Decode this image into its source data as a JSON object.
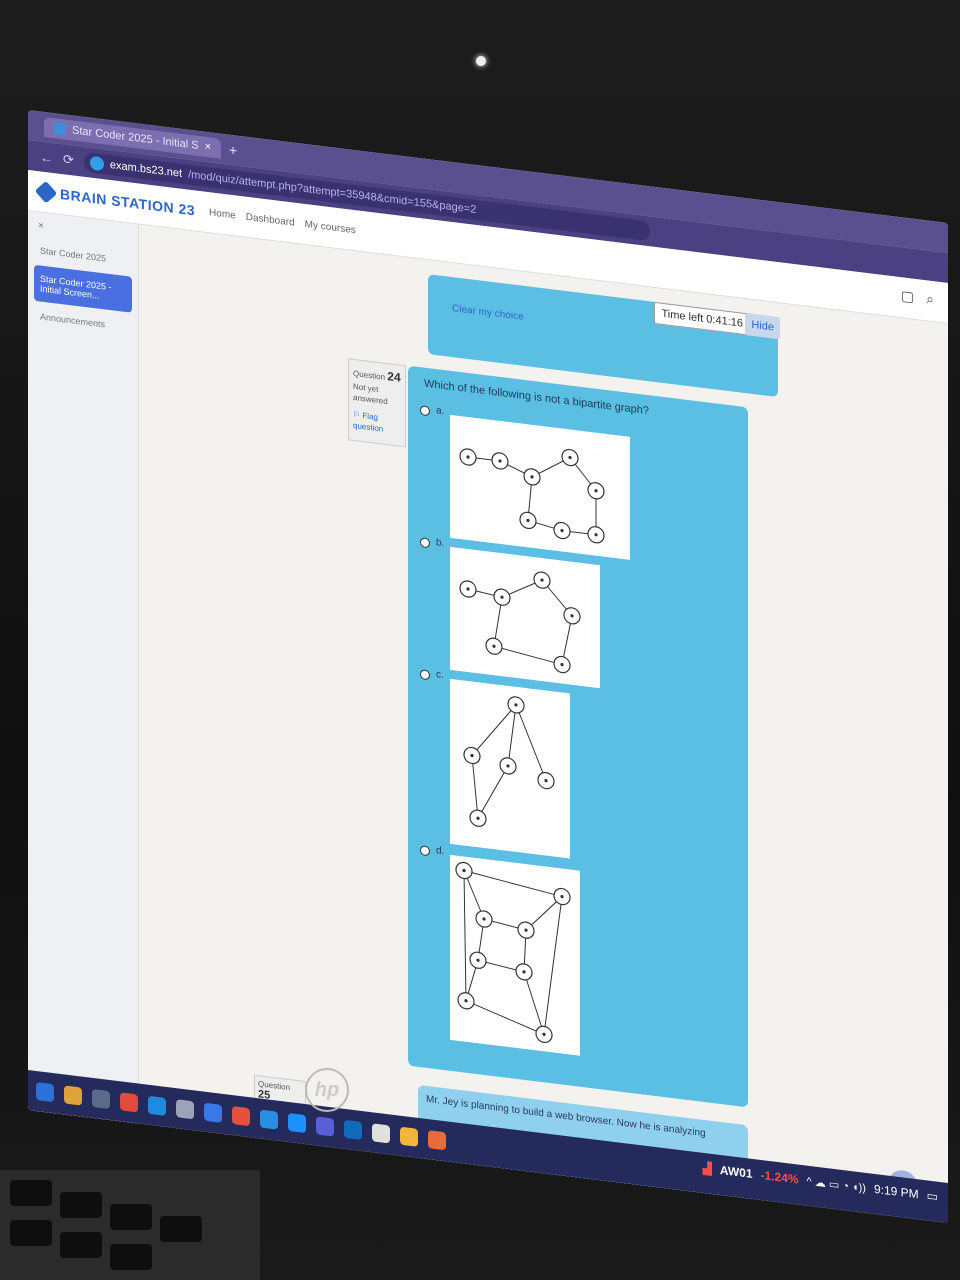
{
  "browser": {
    "tab_title": "Star Coder 2025 - Initial S",
    "tab_close": "×",
    "new_tab": "+",
    "url_host": "exam.bs23.net",
    "url_path": "/mod/quiz/attempt.php?attempt=35948&cmid=155&page=2"
  },
  "site": {
    "brand": "BRAIN STATION 23",
    "nav": [
      "Home",
      "Dashboard",
      "My courses"
    ],
    "icons": [
      "clipboard-icon",
      "search-icon"
    ]
  },
  "sidebar": {
    "close": "×",
    "items": [
      "Star Coder 2025",
      "Star Coder 2025 - Initial Screen...",
      "Announcements"
    ]
  },
  "quiz_top": {
    "clear_choice": "Clear my choice",
    "timer_label": "Time left 0:41:16",
    "hide_label": "Hide"
  },
  "question24": {
    "label": "Question",
    "number": "24",
    "status": "Not yet answered",
    "flag": "Flag question",
    "text": "Which of the following is not a bipartite graph?",
    "options": [
      {
        "letter": "a."
      },
      {
        "letter": "b."
      },
      {
        "letter": "c."
      },
      {
        "letter": "d."
      }
    ]
  },
  "question25": {
    "label": "Question",
    "number": "25",
    "text": "Mr. Jey is planning to build a web browser. Now he is analyzing"
  },
  "taskbar": {
    "stock_name": "AW01",
    "stock_change": "-1.24%",
    "time": "9:19 PM",
    "tray_symbols": "^ ☁ ▭ ◔ ◖))"
  },
  "laptop": {
    "brand": "hp"
  },
  "help": "?"
}
